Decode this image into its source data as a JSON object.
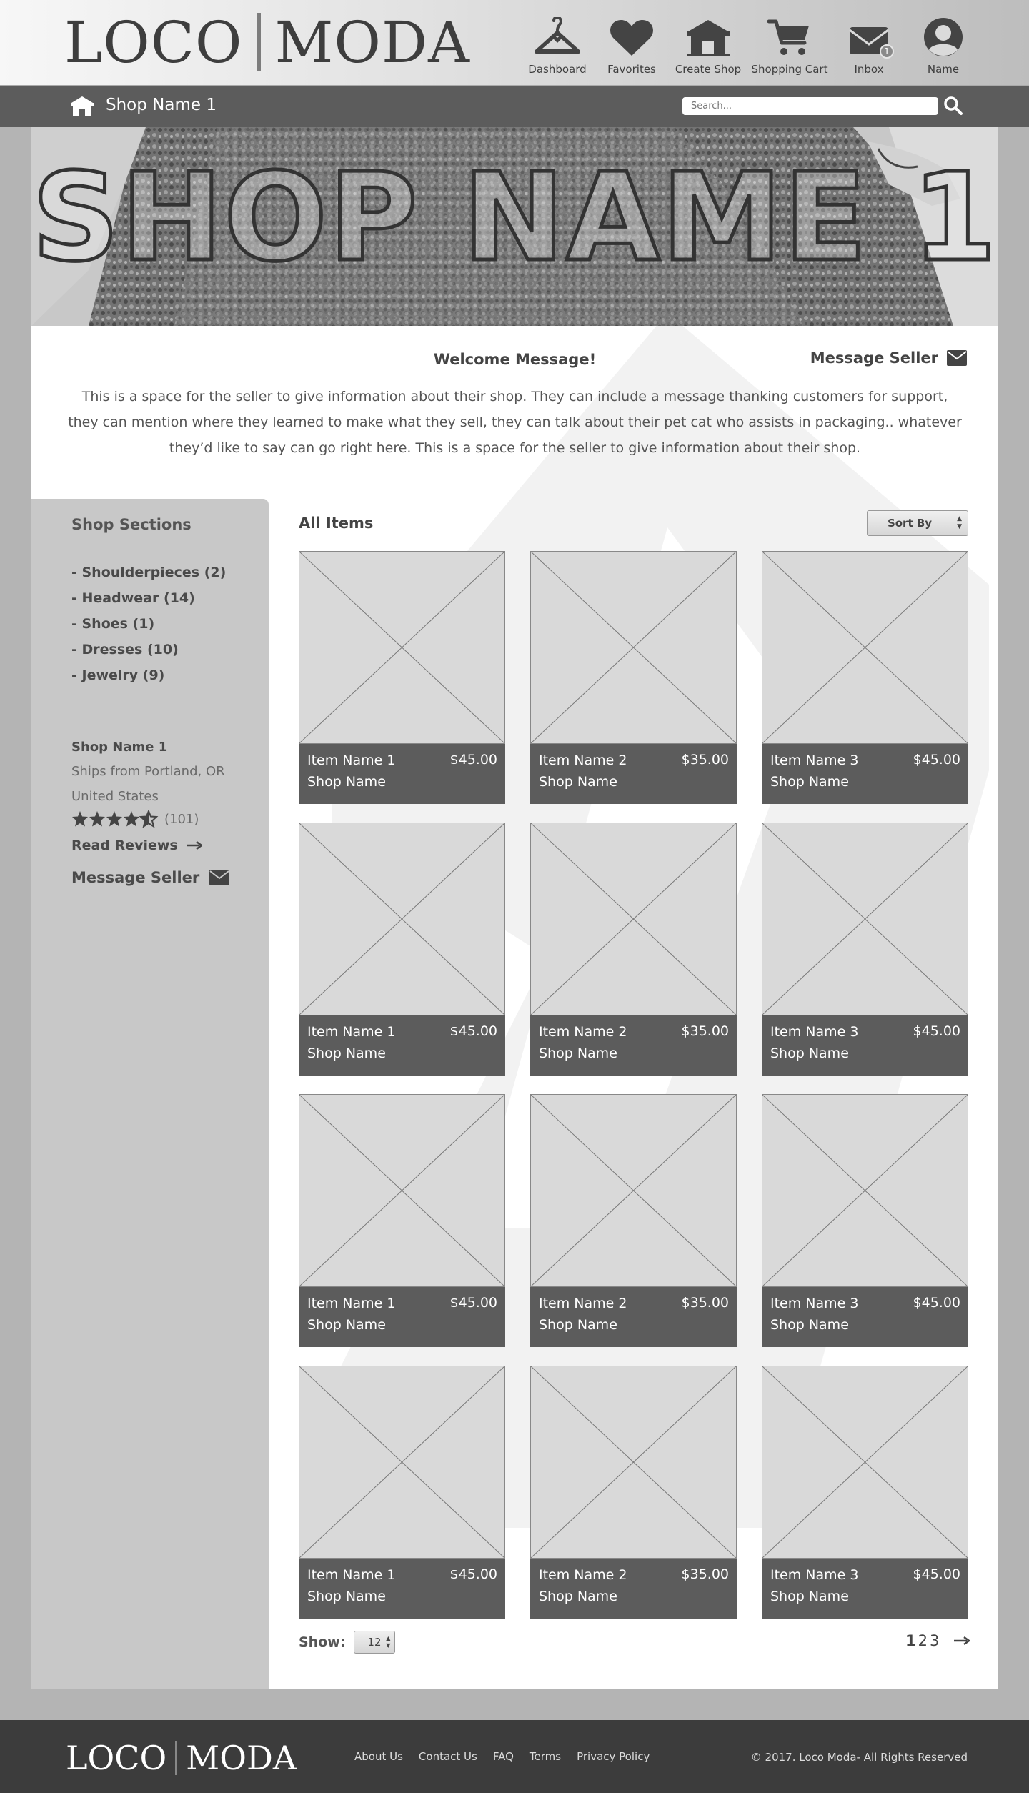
{
  "brand": {
    "part1": "LOCO",
    "part2": "MODA"
  },
  "nav": [
    {
      "label": "Dashboard",
      "icon": "hanger-icon"
    },
    {
      "label": "Favorites",
      "icon": "heart-icon"
    },
    {
      "label": "Create Shop",
      "icon": "shop-icon"
    },
    {
      "label": "Shopping Cart",
      "icon": "cart-icon"
    },
    {
      "label": "Inbox",
      "icon": "envelope-icon",
      "badge": "1"
    },
    {
      "label": "Name",
      "icon": "user-icon"
    }
  ],
  "subnav": {
    "shop_name": "Shop Name 1",
    "search_placeholder": "Search..."
  },
  "banner": {
    "title": "SHOP NAME 1"
  },
  "welcome": {
    "title": "Welcome Message!",
    "message_seller": "Message Seller",
    "text": "This is a space for the seller to give information about their shop.  They can include a message thanking customers for support, they can mention where they learned to make what they sell, they can talk about their pet cat who assists in packaging.. whatever they’d like to say can go right here.  This is a space for the seller to give information about their shop."
  },
  "sidebar": {
    "title": "Shop Sections",
    "sections": [
      "- Shoulderpieces (2)",
      "- Headwear (14)",
      "- Shoes (1)",
      "- Dresses (10)",
      "- Jewelry (9)"
    ],
    "shop_name": "Shop Name 1",
    "ships_from": "Ships from Portland, OR United States",
    "rating": 4.5,
    "review_count": "(101)",
    "read_reviews": "Read Reviews",
    "message_seller": "Message Seller"
  },
  "items": {
    "title": "All Items",
    "sort_label": "Sort By",
    "list": [
      {
        "name": "Item Name 1",
        "price": "$45.00",
        "shop": "Shop Name"
      },
      {
        "name": "Item Name 2",
        "price": "$35.00",
        "shop": "Shop Name"
      },
      {
        "name": "Item Name 3",
        "price": "$45.00",
        "shop": "Shop Name"
      },
      {
        "name": "Item Name 1",
        "price": "$45.00",
        "shop": "Shop Name"
      },
      {
        "name": "Item Name 2",
        "price": "$35.00",
        "shop": "Shop Name"
      },
      {
        "name": "Item Name 3",
        "price": "$45.00",
        "shop": "Shop Name"
      },
      {
        "name": "Item Name 1",
        "price": "$45.00",
        "shop": "Shop Name"
      },
      {
        "name": "Item Name 2",
        "price": "$35.00",
        "shop": "Shop Name"
      },
      {
        "name": "Item Name 3",
        "price": "$45.00",
        "shop": "Shop Name"
      },
      {
        "name": "Item Name 1",
        "price": "$45.00",
        "shop": "Shop Name"
      },
      {
        "name": "Item Name 2",
        "price": "$35.00",
        "shop": "Shop Name"
      },
      {
        "name": "Item Name 3",
        "price": "$45.00",
        "shop": "Shop Name"
      }
    ],
    "show_label": "Show:",
    "show_value": "12",
    "pages": [
      "1",
      "2",
      "3"
    ],
    "current_page": "1"
  },
  "footer": {
    "links": [
      "About Us",
      "Contact Us",
      "FAQ",
      "Terms",
      "Privacy Policy"
    ],
    "copyright": "© 2017.  Loco Moda- All Rights Reserved"
  },
  "colors": {
    "dark_bar": "#5c5c5c",
    "footer": "#3c3c3c",
    "page_bg": "#b4b4b4",
    "sidebar": "#c8c8c8",
    "placeholder": "#d9d9d9"
  }
}
